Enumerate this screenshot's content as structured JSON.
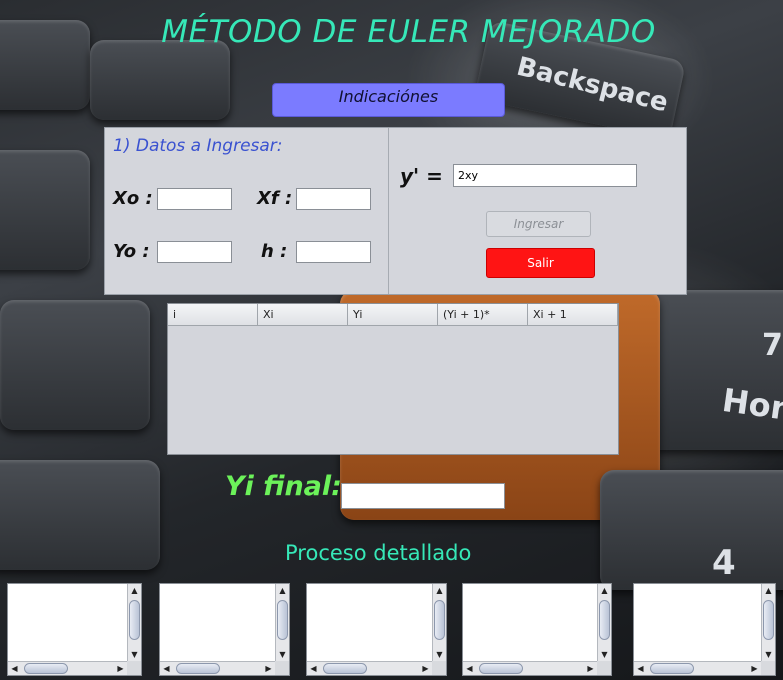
{
  "title": "MÉTODO DE EULER MEJORADO",
  "indicaciones_label": "Indicaciónes",
  "datos": {
    "section_label": "1) Datos a Ingresar:",
    "xo_label": "Xo :",
    "xf_label": "Xf :",
    "yo_label": "Yo :",
    "h_label": "h :",
    "xo_value": "",
    "xf_value": "",
    "yo_value": "",
    "h_value": ""
  },
  "equation": {
    "label": "y' =",
    "value": "2xy"
  },
  "buttons": {
    "ingresar": "Ingresar",
    "salir": "Salir"
  },
  "table": {
    "columns": [
      "i",
      "Xi",
      "Yi",
      "(Yi + 1)*",
      "Xi + 1"
    ]
  },
  "yi_final": {
    "label": "Yi final:",
    "value": ""
  },
  "proceso_label": "Proceso detallado",
  "background_keys": {
    "backspace": "Backspace",
    "home": "Home",
    "seven": "7",
    "four": "4"
  },
  "colors": {
    "title": "#36e8b8",
    "indicaciones_button": "#7b7bff",
    "salir_button": "#ff1414",
    "yi_final_label": "#6cf25a"
  }
}
